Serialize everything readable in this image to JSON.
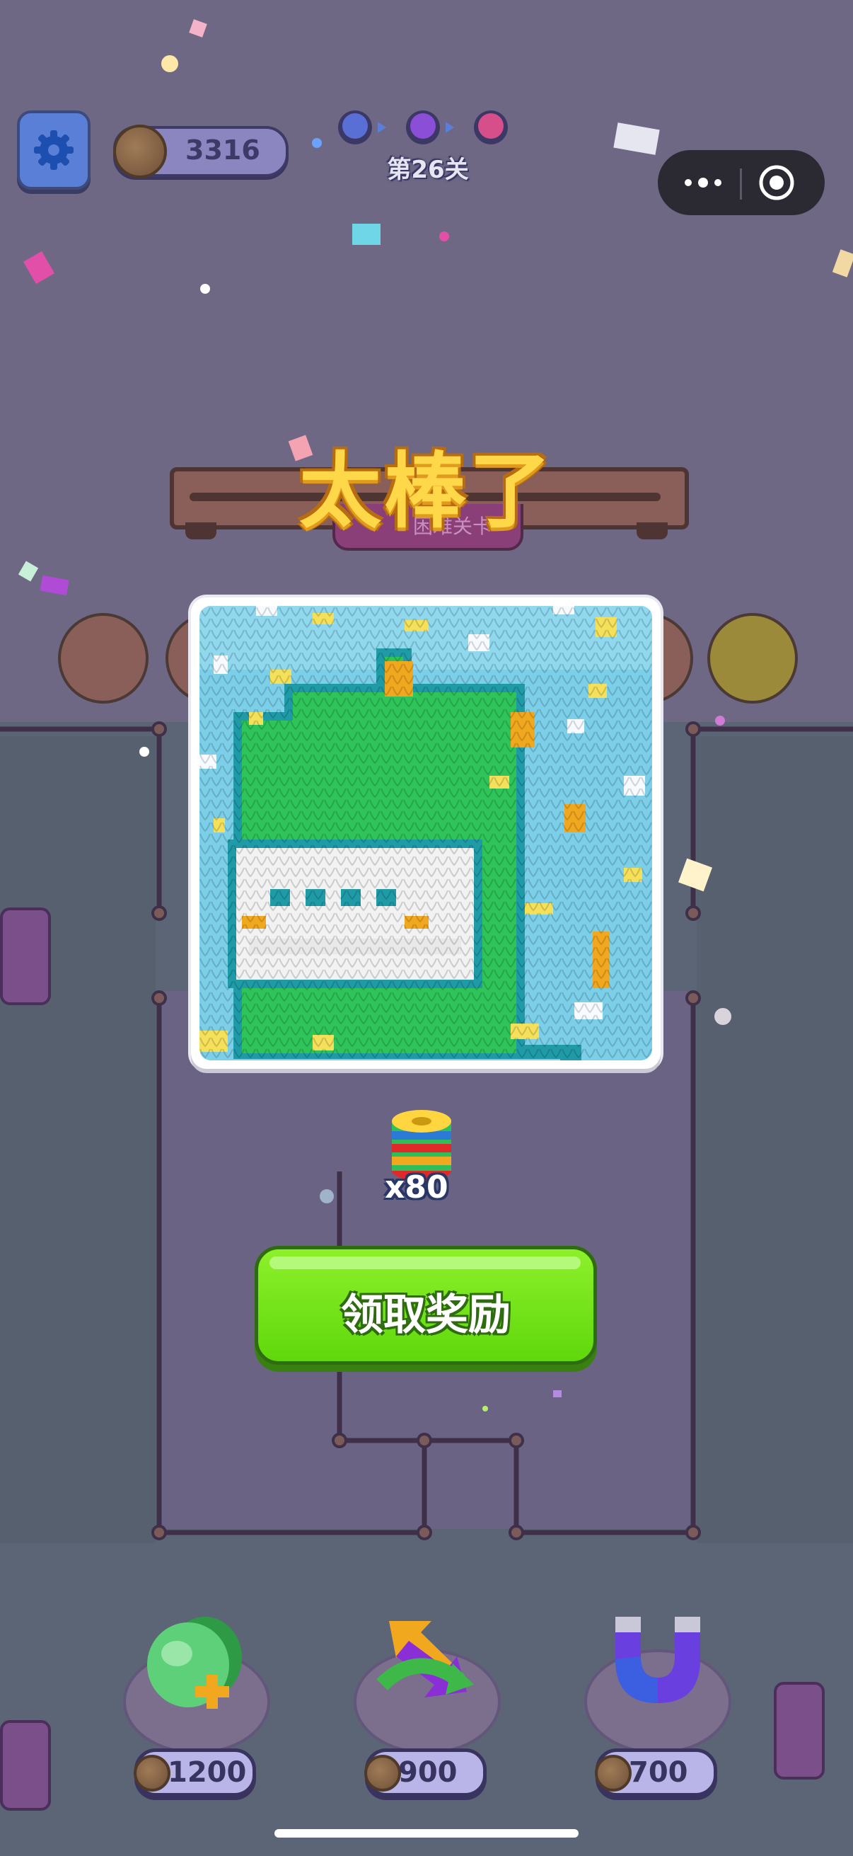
{
  "header": {
    "coins": "3316",
    "level_label": "第26关"
  },
  "result": {
    "title": "太棒了",
    "difficulty_tag": "困难关卡"
  },
  "reward": {
    "count_label": "x80",
    "claim_label": "领取奖励"
  },
  "powerups": [
    {
      "name": "shuffle-bottle",
      "price": "1200"
    },
    {
      "name": "swap-arrows",
      "price": "900"
    },
    {
      "name": "magnet",
      "price": "700"
    }
  ],
  "colors": {
    "accent_green": "#6ee01a",
    "title_yellow": "#ffd84a",
    "knit_sky": "#7ccfe8",
    "knit_green": "#2ec45a",
    "knit_white": "#f2f2f2",
    "knit_teal": "#1f9ba8"
  }
}
